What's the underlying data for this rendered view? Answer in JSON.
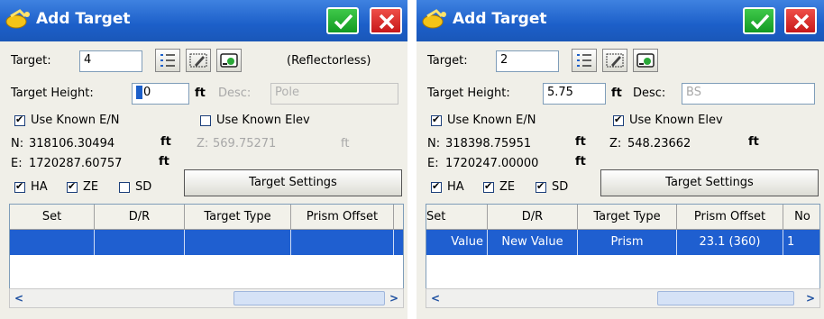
{
  "panels": [
    {
      "title": "Add Target",
      "target_label": "Target:",
      "target_value": "4",
      "target_mode": "(Reflectorless)",
      "height_label": "Target Height:",
      "height_value": "0",
      "height_unit": "ft",
      "desc_label": "Desc:",
      "desc_value": "Pole",
      "use_known_en_label": "Use Known E/N",
      "use_known_en_checked": true,
      "use_known_elev_label": "Use Known Elev",
      "use_known_elev_checked": false,
      "n_label": "N:",
      "n_value": "318106.30494",
      "n_unit": "ft",
      "z_label": "Z:",
      "z_value": "569.75271",
      "z_unit": "ft",
      "e_label": "E:",
      "e_value": "1720287.60757",
      "e_unit": "ft",
      "ha_label": "HA",
      "ha_checked": true,
      "ze_label": "ZE",
      "ze_checked": true,
      "sd_label": "SD",
      "sd_checked": false,
      "settings_button": "Target Settings",
      "columns": [
        "Set",
        "D/R",
        "Target Type",
        "Prism Offset"
      ],
      "row": [
        "",
        "",
        "",
        ""
      ]
    },
    {
      "title": "Add Target",
      "target_label": "Target:",
      "target_value": "2",
      "height_label": "Target Height:",
      "height_value": "5.75",
      "height_unit": "ft",
      "desc_label": "Desc:",
      "desc_value": "BS",
      "use_known_en_label": "Use Known E/N",
      "use_known_en_checked": true,
      "use_known_elev_label": "Use Known Elev",
      "use_known_elev_checked": true,
      "n_label": "N:",
      "n_value": "318398.75951",
      "n_unit": "ft",
      "z_label": "Z:",
      "z_value": "548.23662",
      "z_unit": "ft",
      "e_label": "E:",
      "e_value": "1720247.00000",
      "e_unit": "ft",
      "ha_label": "HA",
      "ha_checked": true,
      "ze_label": "ZE",
      "ze_checked": true,
      "sd_label": "SD",
      "sd_checked": true,
      "settings_button": "Target Settings",
      "columns": [
        "Set",
        "D/R",
        "Target Type",
        "Prism Offset",
        "No"
      ],
      "row": [
        "Value",
        "New Value",
        "Prism",
        "23.1 (360)",
        "1"
      ]
    }
  ],
  "icons": {
    "title": "satellite-dish-icon",
    "ok": "checkmark-icon",
    "close": "close-x-icon",
    "list": "list-icon",
    "edit": "edit-pencil-icon",
    "survey": "survey-instrument-icon",
    "scroll_left": "scroll-left-arrow-icon",
    "scroll_right": "scroll-right-arrow-icon"
  },
  "colors": {
    "titlebar": "#1c5fc9",
    "ok_button": "#1fae2e",
    "close_button": "#d9231f",
    "selected_row": "#1f5fd0"
  }
}
